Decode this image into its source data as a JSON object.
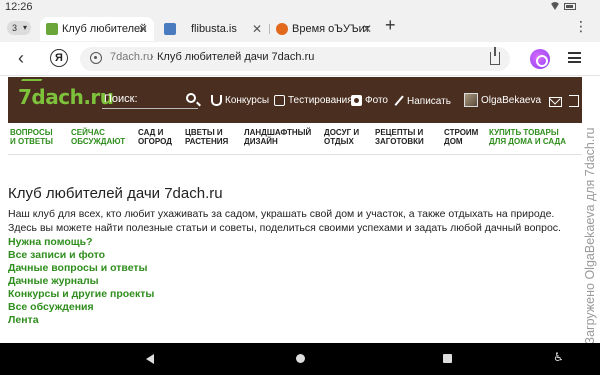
{
  "status_bar": {
    "time": "12:26"
  },
  "tabs": {
    "count": "3",
    "items": [
      {
        "title": "Клуб любителей",
        "close": "✕",
        "favicon_color": "#6aa63a",
        "active": true
      },
      {
        "title": "flibusta.is",
        "close": "✕",
        "favicon_color": "#4a7bbf",
        "active": false
      },
      {
        "title": "Время оЪУЪит",
        "close": "✕",
        "favicon_color": "#e2681b",
        "active": false
      }
    ],
    "new_tab": "+"
  },
  "address_bar": {
    "domain": "7dach.ru",
    "separator": "›",
    "page_title": "Клуб любителей дачи 7dach.ru",
    "yandex_button": "Я"
  },
  "site_header": {
    "logo": "7dach.ru",
    "search_label": "Поиск:",
    "nav": [
      {
        "label": "Конкурсы",
        "icon": "trophy-icon"
      },
      {
        "label": "Тестирования",
        "icon": "thumbs-up-icon"
      },
      {
        "label": "Фото",
        "icon": "camera-icon"
      },
      {
        "label": "Написать",
        "icon": "pencil-icon"
      },
      {
        "label": "OlgaBekaeva",
        "icon": "avatar"
      }
    ],
    "colors": {
      "background": "#4a2e1f",
      "logo": "#7ec23c"
    }
  },
  "categories": [
    {
      "label": "ВОПРОСЫ\nИ ОТВЕТЫ",
      "highlight": true
    },
    {
      "label": "СЕЙЧАС\nОБСУЖДАЮТ",
      "highlight": true
    },
    {
      "label": "САД И\nОГОРОД",
      "highlight": false
    },
    {
      "label": "ЦВЕТЫ И\nРАСТЕНИЯ",
      "highlight": false
    },
    {
      "label": "ЛАНДШАФТНЫЙ\nДИЗАЙН",
      "highlight": false
    },
    {
      "label": "ДОСУГ И\nОТДЫХ",
      "highlight": false
    },
    {
      "label": "РЕЦЕПТЫ И\nЗАГОТОВКИ",
      "highlight": false
    },
    {
      "label": "СТРОИМ\nДОМ",
      "highlight": false
    },
    {
      "label": "КУПИТЬ ТОВАРЫ\nДЛЯ ДОМА И САДА",
      "highlight": true
    }
  ],
  "content": {
    "heading": "Клуб любителей дачи 7dach.ru",
    "intro": "Наш клуб для всех, кто любит ухаживать за садом, украшать свой дом и участок, а также отдыхать на природе. Здесь вы можете найти полезные статьи и советы, поделиться своими успехами и задать любой дачный вопрос.",
    "help_link": "Нужна помощь?",
    "links": [
      "Все записи и фото",
      "Дачные вопросы и ответы",
      "Дачные журналы",
      "Конкурсы и другие проекты",
      "Все обсуждения",
      "Лента"
    ],
    "accent_color": "#2f8e1d"
  },
  "watermark": "Загружено OlgaBekaeva для 7dach.ru"
}
